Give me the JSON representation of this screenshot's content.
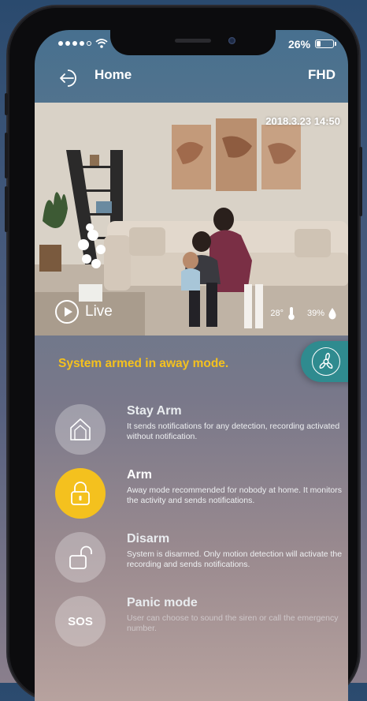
{
  "status_bar": {
    "battery_percent": "26%",
    "battery_level": 0.26
  },
  "header": {
    "title": "Home",
    "quality": "FHD"
  },
  "video": {
    "timestamp": "2018.3.23 14:50",
    "live_label": "Live",
    "temperature": "28°",
    "humidity": "39%"
  },
  "armed_message": "System armed in away mode.",
  "modes": [
    {
      "title": "Stay Arm",
      "description": "It sends notifications for any detection, recording activated without notification.",
      "icon": "house-icon",
      "active": false
    },
    {
      "title": "Arm",
      "description": "Away mode recommended for nobody at home. It monitors the activity and sends notifications.",
      "icon": "lock-closed-icon",
      "active": true
    },
    {
      "title": "Disarm",
      "description": "System is disarmed. Only motion detection will activate the recording and sends notifications.",
      "icon": "lock-open-icon",
      "active": false
    },
    {
      "title": "Panic mode",
      "description": "User can choose to sound the siren or call the emergency number.",
      "icon_text": "SOS",
      "active": false
    }
  ],
  "colors": {
    "accent": "#f4c11e",
    "teal": "#2f8b8f",
    "header_bg": "#47708f"
  }
}
